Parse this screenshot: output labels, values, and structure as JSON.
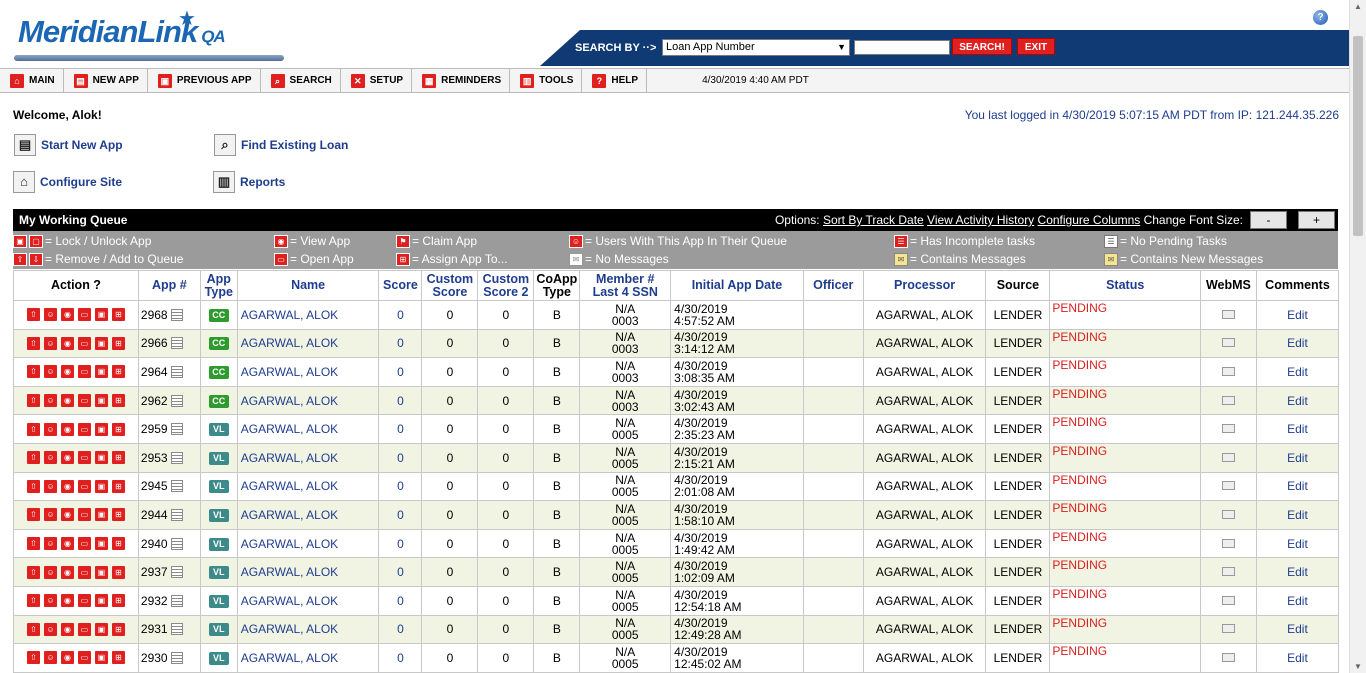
{
  "header": {
    "logo_text": "MeridianLink",
    "logo_suffix": "QA",
    "search_by_label": "SEARCH BY ··>",
    "search_select_value": "Loan App Number",
    "search_button": "SEARCH!",
    "exit_button": "EXIT",
    "help_icon": "question-icon"
  },
  "nav": {
    "items": [
      {
        "label": "MAIN",
        "icon": "home-icon",
        "glyph": "⌂"
      },
      {
        "label": "NEW APP",
        "icon": "new-app-icon",
        "glyph": "▤"
      },
      {
        "label": "PREVIOUS APP",
        "icon": "previous-app-icon",
        "glyph": "▣"
      },
      {
        "label": "SEARCH",
        "icon": "search-icon",
        "glyph": "⌕"
      },
      {
        "label": "SETUP",
        "icon": "setup-icon",
        "glyph": "✕"
      },
      {
        "label": "REMINDERS",
        "icon": "reminders-icon",
        "glyph": "▦"
      },
      {
        "label": "TOOLS",
        "icon": "tools-icon",
        "glyph": "▥"
      },
      {
        "label": "HELP",
        "icon": "help-icon",
        "glyph": "?"
      }
    ],
    "datetime": "4/30/2019 4:40 AM PDT"
  },
  "welcome": "Welcome, Alok!",
  "last_login": "You last logged in 4/30/2019 5:07:15 AM PDT from IP: 121.244.35.226",
  "quick_links": {
    "start_new_app": "Start New App",
    "find_existing_loan": "Find Existing Loan",
    "configure_site": "Configure Site",
    "reports": "Reports"
  },
  "queue": {
    "title": "My Working Queue",
    "options_label": "Options:",
    "sort_by_track_date": "Sort By Track Date",
    "view_activity_history": "View Activity History",
    "configure_columns": "Configure Columns",
    "change_font_size": "Change Font Size:",
    "minus": "-",
    "plus": "+"
  },
  "legend": {
    "lock_unlock": "= Lock / Unlock App",
    "remove_add": "= Remove / Add to Queue",
    "view_app": "= View App",
    "open_app": "= Open App",
    "claim_app": "= Claim App",
    "assign_app": "= Assign App To...",
    "users_with_app": "= Users With This App In Their Queue",
    "no_messages": "= No Messages",
    "incomplete_tasks": "= Has Incomplete tasks",
    "contains_messages": "= Contains Messages",
    "no_pending_tasks": "= No Pending Tasks",
    "contains_new_messages": "= Contains New Messages"
  },
  "table": {
    "headers": {
      "action": "Action ?",
      "app_no": "App #",
      "app_type": "App Type",
      "name": "Name",
      "score": "Score",
      "custom_score": "Custom Score",
      "custom_score2": "Custom Score 2",
      "coapp_type": "CoApp Type",
      "member_ssn": "Member # Last 4 SSN",
      "initial_date": "Initial App Date",
      "officer": "Officer",
      "processor": "Processor",
      "source": "Source",
      "status": "Status",
      "webms": "WebMS",
      "comments": "Comments"
    },
    "rows": [
      {
        "app": "2968",
        "type": "CC",
        "name": "AGARWAL, ALOK",
        "score": "0",
        "cs": "0",
        "cs2": "0",
        "co": "B",
        "mem": "N/A",
        "ssn": "0003",
        "date": "4/30/2019",
        "time": "4:57:52 AM",
        "officer": "",
        "proc": "AGARWAL, ALOK",
        "src": "LENDER",
        "status": "PENDING",
        "edit": "Edit"
      },
      {
        "app": "2966",
        "type": "CC",
        "name": "AGARWAL, ALOK",
        "score": "0",
        "cs": "0",
        "cs2": "0",
        "co": "B",
        "mem": "N/A",
        "ssn": "0003",
        "date": "4/30/2019",
        "time": "3:14:12 AM",
        "officer": "",
        "proc": "AGARWAL, ALOK",
        "src": "LENDER",
        "status": "PENDING",
        "edit": "Edit"
      },
      {
        "app": "2964",
        "type": "CC",
        "name": "AGARWAL, ALOK",
        "score": "0",
        "cs": "0",
        "cs2": "0",
        "co": "B",
        "mem": "N/A",
        "ssn": "0003",
        "date": "4/30/2019",
        "time": "3:08:35 AM",
        "officer": "",
        "proc": "AGARWAL, ALOK",
        "src": "LENDER",
        "status": "PENDING",
        "edit": "Edit"
      },
      {
        "app": "2962",
        "type": "CC",
        "name": "AGARWAL, ALOK",
        "score": "0",
        "cs": "0",
        "cs2": "0",
        "co": "B",
        "mem": "N/A",
        "ssn": "0003",
        "date": "4/30/2019",
        "time": "3:02:43 AM",
        "officer": "",
        "proc": "AGARWAL, ALOK",
        "src": "LENDER",
        "status": "PENDING",
        "edit": "Edit"
      },
      {
        "app": "2959",
        "type": "VL",
        "name": "AGARWAL, ALOK",
        "score": "0",
        "cs": "0",
        "cs2": "0",
        "co": "B",
        "mem": "N/A",
        "ssn": "0005",
        "date": "4/30/2019",
        "time": "2:35:23 AM",
        "officer": "",
        "proc": "AGARWAL, ALOK",
        "src": "LENDER",
        "status": "PENDING",
        "edit": "Edit"
      },
      {
        "app": "2953",
        "type": "VL",
        "name": "AGARWAL, ALOK",
        "score": "0",
        "cs": "0",
        "cs2": "0",
        "co": "B",
        "mem": "N/A",
        "ssn": "0005",
        "date": "4/30/2019",
        "time": "2:15:21 AM",
        "officer": "",
        "proc": "AGARWAL, ALOK",
        "src": "LENDER",
        "status": "PENDING",
        "edit": "Edit"
      },
      {
        "app": "2945",
        "type": "VL",
        "name": "AGARWAL, ALOK",
        "score": "0",
        "cs": "0",
        "cs2": "0",
        "co": "B",
        "mem": "N/A",
        "ssn": "0005",
        "date": "4/30/2019",
        "time": "2:01:08 AM",
        "officer": "",
        "proc": "AGARWAL, ALOK",
        "src": "LENDER",
        "status": "PENDING",
        "edit": "Edit"
      },
      {
        "app": "2944",
        "type": "VL",
        "name": "AGARWAL, ALOK",
        "score": "0",
        "cs": "0",
        "cs2": "0",
        "co": "B",
        "mem": "N/A",
        "ssn": "0005",
        "date": "4/30/2019",
        "time": "1:58:10 AM",
        "officer": "",
        "proc": "AGARWAL, ALOK",
        "src": "LENDER",
        "status": "PENDING",
        "edit": "Edit"
      },
      {
        "app": "2940",
        "type": "VL",
        "name": "AGARWAL, ALOK",
        "score": "0",
        "cs": "0",
        "cs2": "0",
        "co": "B",
        "mem": "N/A",
        "ssn": "0005",
        "date": "4/30/2019",
        "time": "1:49:42 AM",
        "officer": "",
        "proc": "AGARWAL, ALOK",
        "src": "LENDER",
        "status": "PENDING",
        "edit": "Edit"
      },
      {
        "app": "2937",
        "type": "VL",
        "name": "AGARWAL, ALOK",
        "score": "0",
        "cs": "0",
        "cs2": "0",
        "co": "B",
        "mem": "N/A",
        "ssn": "0005",
        "date": "4/30/2019",
        "time": "1:02:09 AM",
        "officer": "",
        "proc": "AGARWAL, ALOK",
        "src": "LENDER",
        "status": "PENDING",
        "edit": "Edit"
      },
      {
        "app": "2932",
        "type": "VL",
        "name": "AGARWAL, ALOK",
        "score": "0",
        "cs": "0",
        "cs2": "0",
        "co": "B",
        "mem": "N/A",
        "ssn": "0005",
        "date": "4/30/2019",
        "time": "12:54:18 AM",
        "officer": "",
        "proc": "AGARWAL, ALOK",
        "src": "LENDER",
        "status": "PENDING",
        "edit": "Edit"
      },
      {
        "app": "2931",
        "type": "VL",
        "name": "AGARWAL, ALOK",
        "score": "0",
        "cs": "0",
        "cs2": "0",
        "co": "B",
        "mem": "N/A",
        "ssn": "0005",
        "date": "4/30/2019",
        "time": "12:49:28 AM",
        "officer": "",
        "proc": "AGARWAL, ALOK",
        "src": "LENDER",
        "status": "PENDING",
        "edit": "Edit"
      },
      {
        "app": "2930",
        "type": "VL",
        "name": "AGARWAL, ALOK",
        "score": "0",
        "cs": "0",
        "cs2": "0",
        "co": "B",
        "mem": "N/A",
        "ssn": "0005",
        "date": "4/30/2019",
        "time": "12:45:02 AM",
        "officer": "",
        "proc": "AGARWAL, ALOK",
        "src": "LENDER",
        "status": "PENDING",
        "edit": "Edit"
      }
    ]
  },
  "colors": {
    "brand_blue": "#1b67b3",
    "header_navy": "#0f3a73",
    "accent_red": "#e01f1f",
    "link_blue": "#1f3d8e",
    "row_alt": "#f1f4e3"
  }
}
